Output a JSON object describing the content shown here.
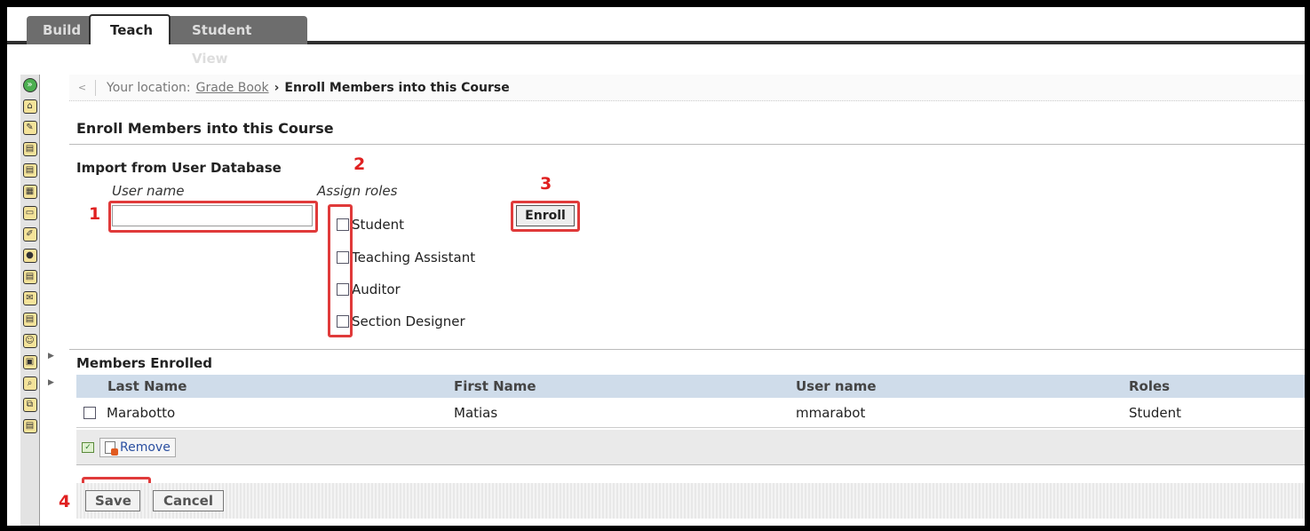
{
  "tabs": [
    {
      "label": "Build"
    },
    {
      "label": "Teach"
    },
    {
      "label": "Student View"
    }
  ],
  "breadcrumb": {
    "back": "<",
    "prefix": "Your location:",
    "link": "Grade Book",
    "separator": "›",
    "current": "Enroll Members into this Course"
  },
  "page_title": "Enroll Members into this Course",
  "import": {
    "title": "Import from User Database",
    "username_label": "User name",
    "username_value": "",
    "roles_label": "Assign roles",
    "roles": [
      "Student",
      "Teaching Assistant",
      "Auditor",
      "Section Designer"
    ],
    "enroll_label": "Enroll"
  },
  "annotations": [
    "1",
    "2",
    "3",
    "4"
  ],
  "members": {
    "title": "Members Enrolled",
    "columns": [
      "Last Name",
      "First Name",
      "User name",
      "Roles"
    ],
    "rows": [
      {
        "last": "Marabotto",
        "first": "Matias",
        "username": "mmarabot",
        "roles": "Student"
      }
    ],
    "remove_label": "Remove"
  },
  "footer": {
    "save_label": "Save",
    "cancel_label": "Cancel"
  },
  "colors": {
    "annotation_red": "#e03a3a",
    "table_header": "#cfdcea",
    "tab_inactive": "#6d6d6d"
  }
}
